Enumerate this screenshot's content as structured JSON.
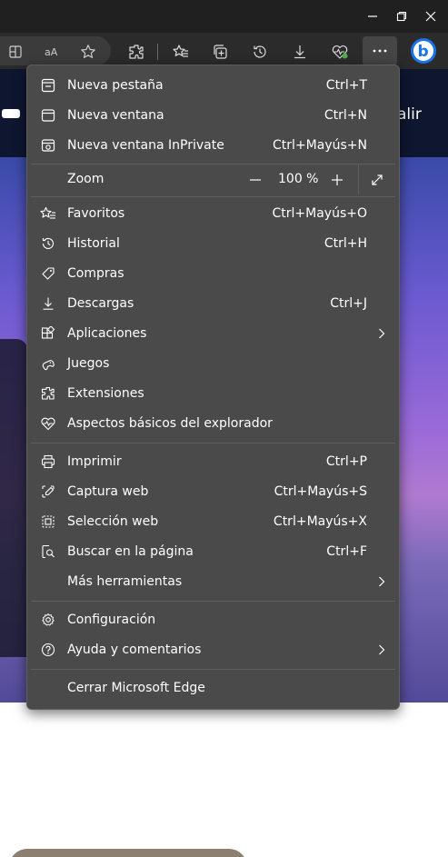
{
  "page": {
    "nav_partial_text": "alir"
  },
  "menu": {
    "items_top": [
      {
        "label": "Nueva pestaña",
        "shortcut": "Ctrl+T"
      },
      {
        "label": "Nueva ventana",
        "shortcut": "Ctrl+N"
      },
      {
        "label": "Nueva ventana InPrivate",
        "shortcut": "Ctrl+Mayús+N"
      }
    ],
    "zoom": {
      "label": "Zoom",
      "value": "100 %"
    },
    "items_mid": [
      {
        "label": "Favoritos",
        "shortcut": "Ctrl+Mayús+O"
      },
      {
        "label": "Historial",
        "shortcut": "Ctrl+H"
      },
      {
        "label": "Compras",
        "shortcut": ""
      },
      {
        "label": "Descargas",
        "shortcut": "Ctrl+J"
      },
      {
        "label": "Aplicaciones",
        "shortcut": ""
      },
      {
        "label": "Juegos",
        "shortcut": ""
      },
      {
        "label": "Extensiones",
        "shortcut": ""
      },
      {
        "label": "Aspectos básicos del explorador",
        "shortcut": ""
      }
    ],
    "items_tools": [
      {
        "label": "Imprimir",
        "shortcut": "Ctrl+P"
      },
      {
        "label": "Captura web",
        "shortcut": "Ctrl+Mayús+S"
      },
      {
        "label": "Selección web",
        "shortcut": "Ctrl+Mayús+X"
      },
      {
        "label": "Buscar en la página",
        "shortcut": "Ctrl+F"
      },
      {
        "label": "Más herramientas",
        "shortcut": ""
      }
    ],
    "items_settings": [
      {
        "label": "Configuración"
      },
      {
        "label": "Ayuda y comentarios"
      }
    ],
    "close_label": "Cerrar Microsoft Edge"
  },
  "colors": {
    "menu_bg": "#4a4a4a",
    "toolbar_bg": "#2b2b2b",
    "bing_accent": "#1a73e8",
    "heart_badge": "#4caf50"
  },
  "icons": {
    "toolbar": [
      "split-screen-icon",
      "read-aloud-icon",
      "favorite-star-icon",
      "extensions-icon",
      "favorites-icon",
      "collections-icon",
      "history-icon",
      "download-icon",
      "browser-essentials-icon",
      "more-icon",
      "bing-copilot-icon"
    ]
  }
}
